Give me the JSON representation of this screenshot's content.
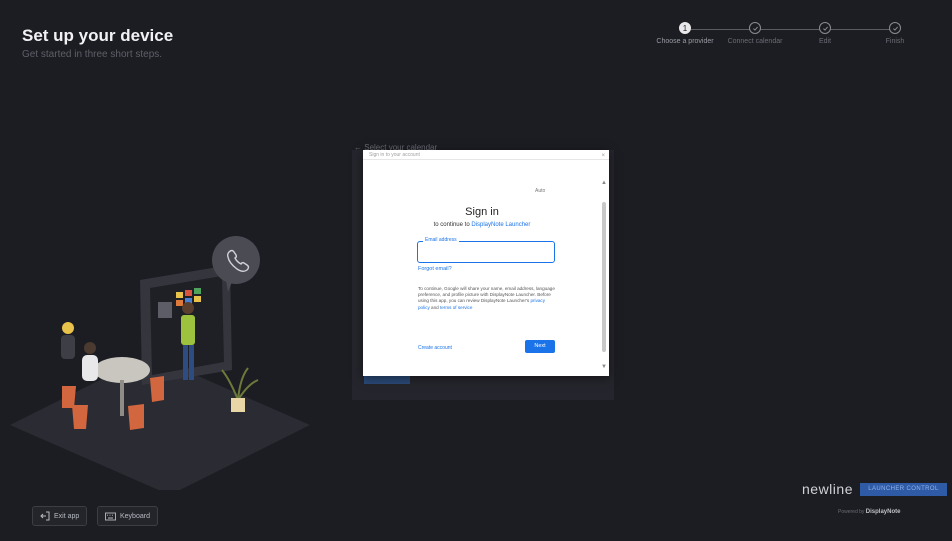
{
  "header": {
    "title": "Set up your device",
    "subtitle": "Get started in three short steps."
  },
  "stepper": [
    {
      "label": "Choose a provider",
      "number": "1",
      "state": "active"
    },
    {
      "label": "Connect calendar",
      "number": "",
      "state": "pending"
    },
    {
      "label": "Edit",
      "number": "",
      "state": "pending"
    },
    {
      "label": "Finish",
      "number": "",
      "state": "pending"
    }
  ],
  "back_link": "Select your calendar",
  "dialog": {
    "top_label": "Sign in to your account",
    "language": "Auto",
    "heading": "Sign in",
    "continue_prefix": "to continue to ",
    "continue_app": "DisplayNote Launcher",
    "email_label": "Email address",
    "forgot_link": "Forgot email?",
    "privacy_text": "To continue, Google will share your name, email address, language preference, and profile picture with DisplayNote Launcher. Before using this app, you can review DisplayNote Launcher's ",
    "privacy_link": "privacy policy",
    "privacy_and": " and ",
    "terms_link": "terms of service",
    "create_account": "Create account",
    "next_label": "Next"
  },
  "brand": {
    "name": "newline",
    "product": "LAUNCHER CONTROL",
    "powered_prefix": "Powered by ",
    "powered_brand": "DisplayNote"
  },
  "bottom_buttons": {
    "exit_app": "Exit app",
    "keyboard": "Keyboard"
  },
  "colors": {
    "background": "#1c1d23",
    "accent": "#1a73e8",
    "brand_box": "#2e5aa6"
  }
}
